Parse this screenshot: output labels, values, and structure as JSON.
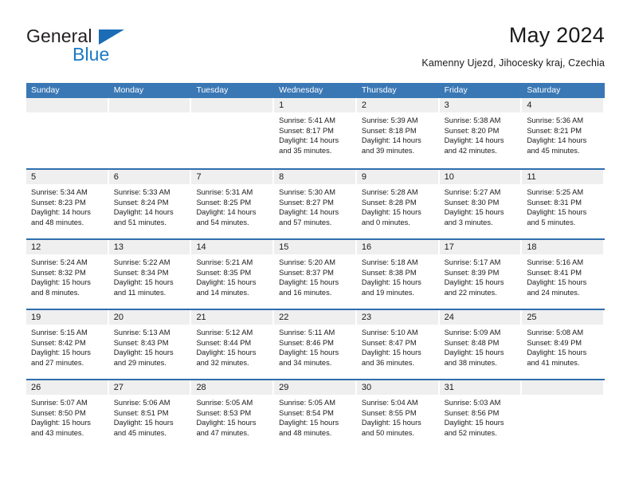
{
  "brand": {
    "name_top": "General",
    "name_bottom": "Blue",
    "accent_color": "#1b79c4",
    "triangle_color": "#1b6cb5"
  },
  "header": {
    "title": "May 2024",
    "location": "Kamenny Ujezd, Jihocesky kraj, Czechia"
  },
  "theme": {
    "header_blue": "#3a78b5",
    "row_divider_blue": "#2f6fad",
    "day_band_gray": "#efeff0"
  },
  "weekdays": [
    "Sunday",
    "Monday",
    "Tuesday",
    "Wednesday",
    "Thursday",
    "Friday",
    "Saturday"
  ],
  "weeks": [
    [
      {
        "day": "",
        "sunrise": "",
        "sunset": "",
        "daylight_1": "",
        "daylight_2": ""
      },
      {
        "day": "",
        "sunrise": "",
        "sunset": "",
        "daylight_1": "",
        "daylight_2": ""
      },
      {
        "day": "",
        "sunrise": "",
        "sunset": "",
        "daylight_1": "",
        "daylight_2": ""
      },
      {
        "day": "1",
        "sunrise": "Sunrise: 5:41 AM",
        "sunset": "Sunset: 8:17 PM",
        "daylight_1": "Daylight: 14 hours",
        "daylight_2": "and 35 minutes."
      },
      {
        "day": "2",
        "sunrise": "Sunrise: 5:39 AM",
        "sunset": "Sunset: 8:18 PM",
        "daylight_1": "Daylight: 14 hours",
        "daylight_2": "and 39 minutes."
      },
      {
        "day": "3",
        "sunrise": "Sunrise: 5:38 AM",
        "sunset": "Sunset: 8:20 PM",
        "daylight_1": "Daylight: 14 hours",
        "daylight_2": "and 42 minutes."
      },
      {
        "day": "4",
        "sunrise": "Sunrise: 5:36 AM",
        "sunset": "Sunset: 8:21 PM",
        "daylight_1": "Daylight: 14 hours",
        "daylight_2": "and 45 minutes."
      }
    ],
    [
      {
        "day": "5",
        "sunrise": "Sunrise: 5:34 AM",
        "sunset": "Sunset: 8:23 PM",
        "daylight_1": "Daylight: 14 hours",
        "daylight_2": "and 48 minutes."
      },
      {
        "day": "6",
        "sunrise": "Sunrise: 5:33 AM",
        "sunset": "Sunset: 8:24 PM",
        "daylight_1": "Daylight: 14 hours",
        "daylight_2": "and 51 minutes."
      },
      {
        "day": "7",
        "sunrise": "Sunrise: 5:31 AM",
        "sunset": "Sunset: 8:25 PM",
        "daylight_1": "Daylight: 14 hours",
        "daylight_2": "and 54 minutes."
      },
      {
        "day": "8",
        "sunrise": "Sunrise: 5:30 AM",
        "sunset": "Sunset: 8:27 PM",
        "daylight_1": "Daylight: 14 hours",
        "daylight_2": "and 57 minutes."
      },
      {
        "day": "9",
        "sunrise": "Sunrise: 5:28 AM",
        "sunset": "Sunset: 8:28 PM",
        "daylight_1": "Daylight: 15 hours",
        "daylight_2": "and 0 minutes."
      },
      {
        "day": "10",
        "sunrise": "Sunrise: 5:27 AM",
        "sunset": "Sunset: 8:30 PM",
        "daylight_1": "Daylight: 15 hours",
        "daylight_2": "and 3 minutes."
      },
      {
        "day": "11",
        "sunrise": "Sunrise: 5:25 AM",
        "sunset": "Sunset: 8:31 PM",
        "daylight_1": "Daylight: 15 hours",
        "daylight_2": "and 5 minutes."
      }
    ],
    [
      {
        "day": "12",
        "sunrise": "Sunrise: 5:24 AM",
        "sunset": "Sunset: 8:32 PM",
        "daylight_1": "Daylight: 15 hours",
        "daylight_2": "and 8 minutes."
      },
      {
        "day": "13",
        "sunrise": "Sunrise: 5:22 AM",
        "sunset": "Sunset: 8:34 PM",
        "daylight_1": "Daylight: 15 hours",
        "daylight_2": "and 11 minutes."
      },
      {
        "day": "14",
        "sunrise": "Sunrise: 5:21 AM",
        "sunset": "Sunset: 8:35 PM",
        "daylight_1": "Daylight: 15 hours",
        "daylight_2": "and 14 minutes."
      },
      {
        "day": "15",
        "sunrise": "Sunrise: 5:20 AM",
        "sunset": "Sunset: 8:37 PM",
        "daylight_1": "Daylight: 15 hours",
        "daylight_2": "and 16 minutes."
      },
      {
        "day": "16",
        "sunrise": "Sunrise: 5:18 AM",
        "sunset": "Sunset: 8:38 PM",
        "daylight_1": "Daylight: 15 hours",
        "daylight_2": "and 19 minutes."
      },
      {
        "day": "17",
        "sunrise": "Sunrise: 5:17 AM",
        "sunset": "Sunset: 8:39 PM",
        "daylight_1": "Daylight: 15 hours",
        "daylight_2": "and 22 minutes."
      },
      {
        "day": "18",
        "sunrise": "Sunrise: 5:16 AM",
        "sunset": "Sunset: 8:41 PM",
        "daylight_1": "Daylight: 15 hours",
        "daylight_2": "and 24 minutes."
      }
    ],
    [
      {
        "day": "19",
        "sunrise": "Sunrise: 5:15 AM",
        "sunset": "Sunset: 8:42 PM",
        "daylight_1": "Daylight: 15 hours",
        "daylight_2": "and 27 minutes."
      },
      {
        "day": "20",
        "sunrise": "Sunrise: 5:13 AM",
        "sunset": "Sunset: 8:43 PM",
        "daylight_1": "Daylight: 15 hours",
        "daylight_2": "and 29 minutes."
      },
      {
        "day": "21",
        "sunrise": "Sunrise: 5:12 AM",
        "sunset": "Sunset: 8:44 PM",
        "daylight_1": "Daylight: 15 hours",
        "daylight_2": "and 32 minutes."
      },
      {
        "day": "22",
        "sunrise": "Sunrise: 5:11 AM",
        "sunset": "Sunset: 8:46 PM",
        "daylight_1": "Daylight: 15 hours",
        "daylight_2": "and 34 minutes."
      },
      {
        "day": "23",
        "sunrise": "Sunrise: 5:10 AM",
        "sunset": "Sunset: 8:47 PM",
        "daylight_1": "Daylight: 15 hours",
        "daylight_2": "and 36 minutes."
      },
      {
        "day": "24",
        "sunrise": "Sunrise: 5:09 AM",
        "sunset": "Sunset: 8:48 PM",
        "daylight_1": "Daylight: 15 hours",
        "daylight_2": "and 38 minutes."
      },
      {
        "day": "25",
        "sunrise": "Sunrise: 5:08 AM",
        "sunset": "Sunset: 8:49 PM",
        "daylight_1": "Daylight: 15 hours",
        "daylight_2": "and 41 minutes."
      }
    ],
    [
      {
        "day": "26",
        "sunrise": "Sunrise: 5:07 AM",
        "sunset": "Sunset: 8:50 PM",
        "daylight_1": "Daylight: 15 hours",
        "daylight_2": "and 43 minutes."
      },
      {
        "day": "27",
        "sunrise": "Sunrise: 5:06 AM",
        "sunset": "Sunset: 8:51 PM",
        "daylight_1": "Daylight: 15 hours",
        "daylight_2": "and 45 minutes."
      },
      {
        "day": "28",
        "sunrise": "Sunrise: 5:05 AM",
        "sunset": "Sunset: 8:53 PM",
        "daylight_1": "Daylight: 15 hours",
        "daylight_2": "and 47 minutes."
      },
      {
        "day": "29",
        "sunrise": "Sunrise: 5:05 AM",
        "sunset": "Sunset: 8:54 PM",
        "daylight_1": "Daylight: 15 hours",
        "daylight_2": "and 48 minutes."
      },
      {
        "day": "30",
        "sunrise": "Sunrise: 5:04 AM",
        "sunset": "Sunset: 8:55 PM",
        "daylight_1": "Daylight: 15 hours",
        "daylight_2": "and 50 minutes."
      },
      {
        "day": "31",
        "sunrise": "Sunrise: 5:03 AM",
        "sunset": "Sunset: 8:56 PM",
        "daylight_1": "Daylight: 15 hours",
        "daylight_2": "and 52 minutes."
      },
      {
        "day": "",
        "sunrise": "",
        "sunset": "",
        "daylight_1": "",
        "daylight_2": ""
      }
    ]
  ]
}
